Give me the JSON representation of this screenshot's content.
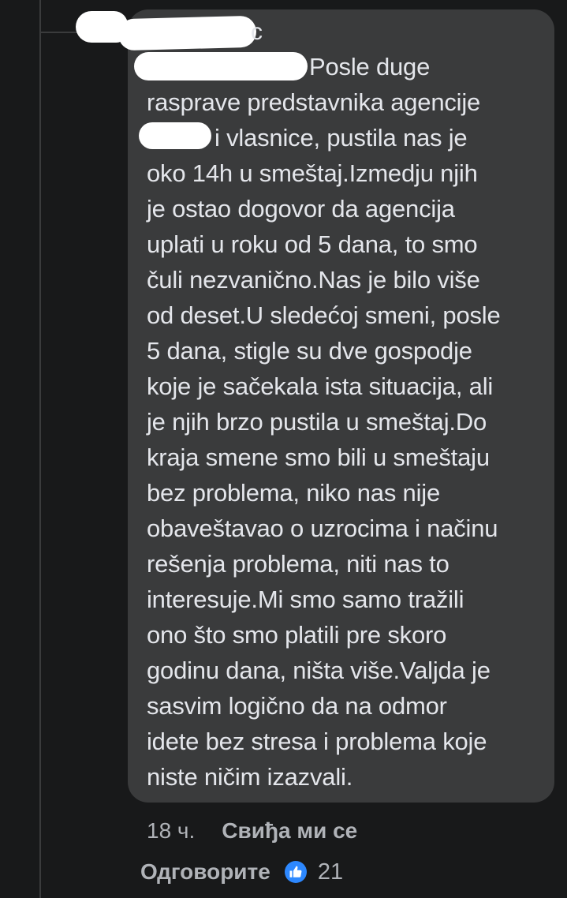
{
  "comment": {
    "author_suffix": "c",
    "text_lines": [
      "Posle duge",
      "rasprave predstavnika agencije",
      "i vlasnice, pustila nas je",
      "oko 14h u smeštaj.Izmedju njih",
      "je ostao dogovor da agencija",
      "uplati u roku od 5 dana, to smo",
      "čuli nezvanično.Nas je bilo više",
      "od deset.U sledećoj smeni, posle",
      "5 dana, stigle su dve gospodje",
      "koje je sačekala ista situacija, ali",
      "je njih brzo pustila u smeštaj.Do",
      "kraja smene smo bili u smeštaju",
      "bez problema, niko nas nije",
      "obaveštavao o uzrocima i načinu",
      "rešenja problema, niti nas to",
      "interesuje.Mi smo samo tražili",
      "ono što smo platili pre skoro",
      "godinu dana, ništa više.Valjda je",
      "sasvim logično da na odmor",
      "idete bez stresa i problema koje",
      "niste ničim izazvali."
    ]
  },
  "meta": {
    "timestamp": "18 ч.",
    "like_label": "Свиђа ми се",
    "reply_label": "Одговорите",
    "reaction_icon": "thumbs-up-icon",
    "reaction_count": "21"
  },
  "colors": {
    "background": "#18191a",
    "bubble": "#3a3b3c",
    "text": "#e4e6eb",
    "secondary_text": "#b0b3b8",
    "like_blue": "#2d88ff"
  }
}
